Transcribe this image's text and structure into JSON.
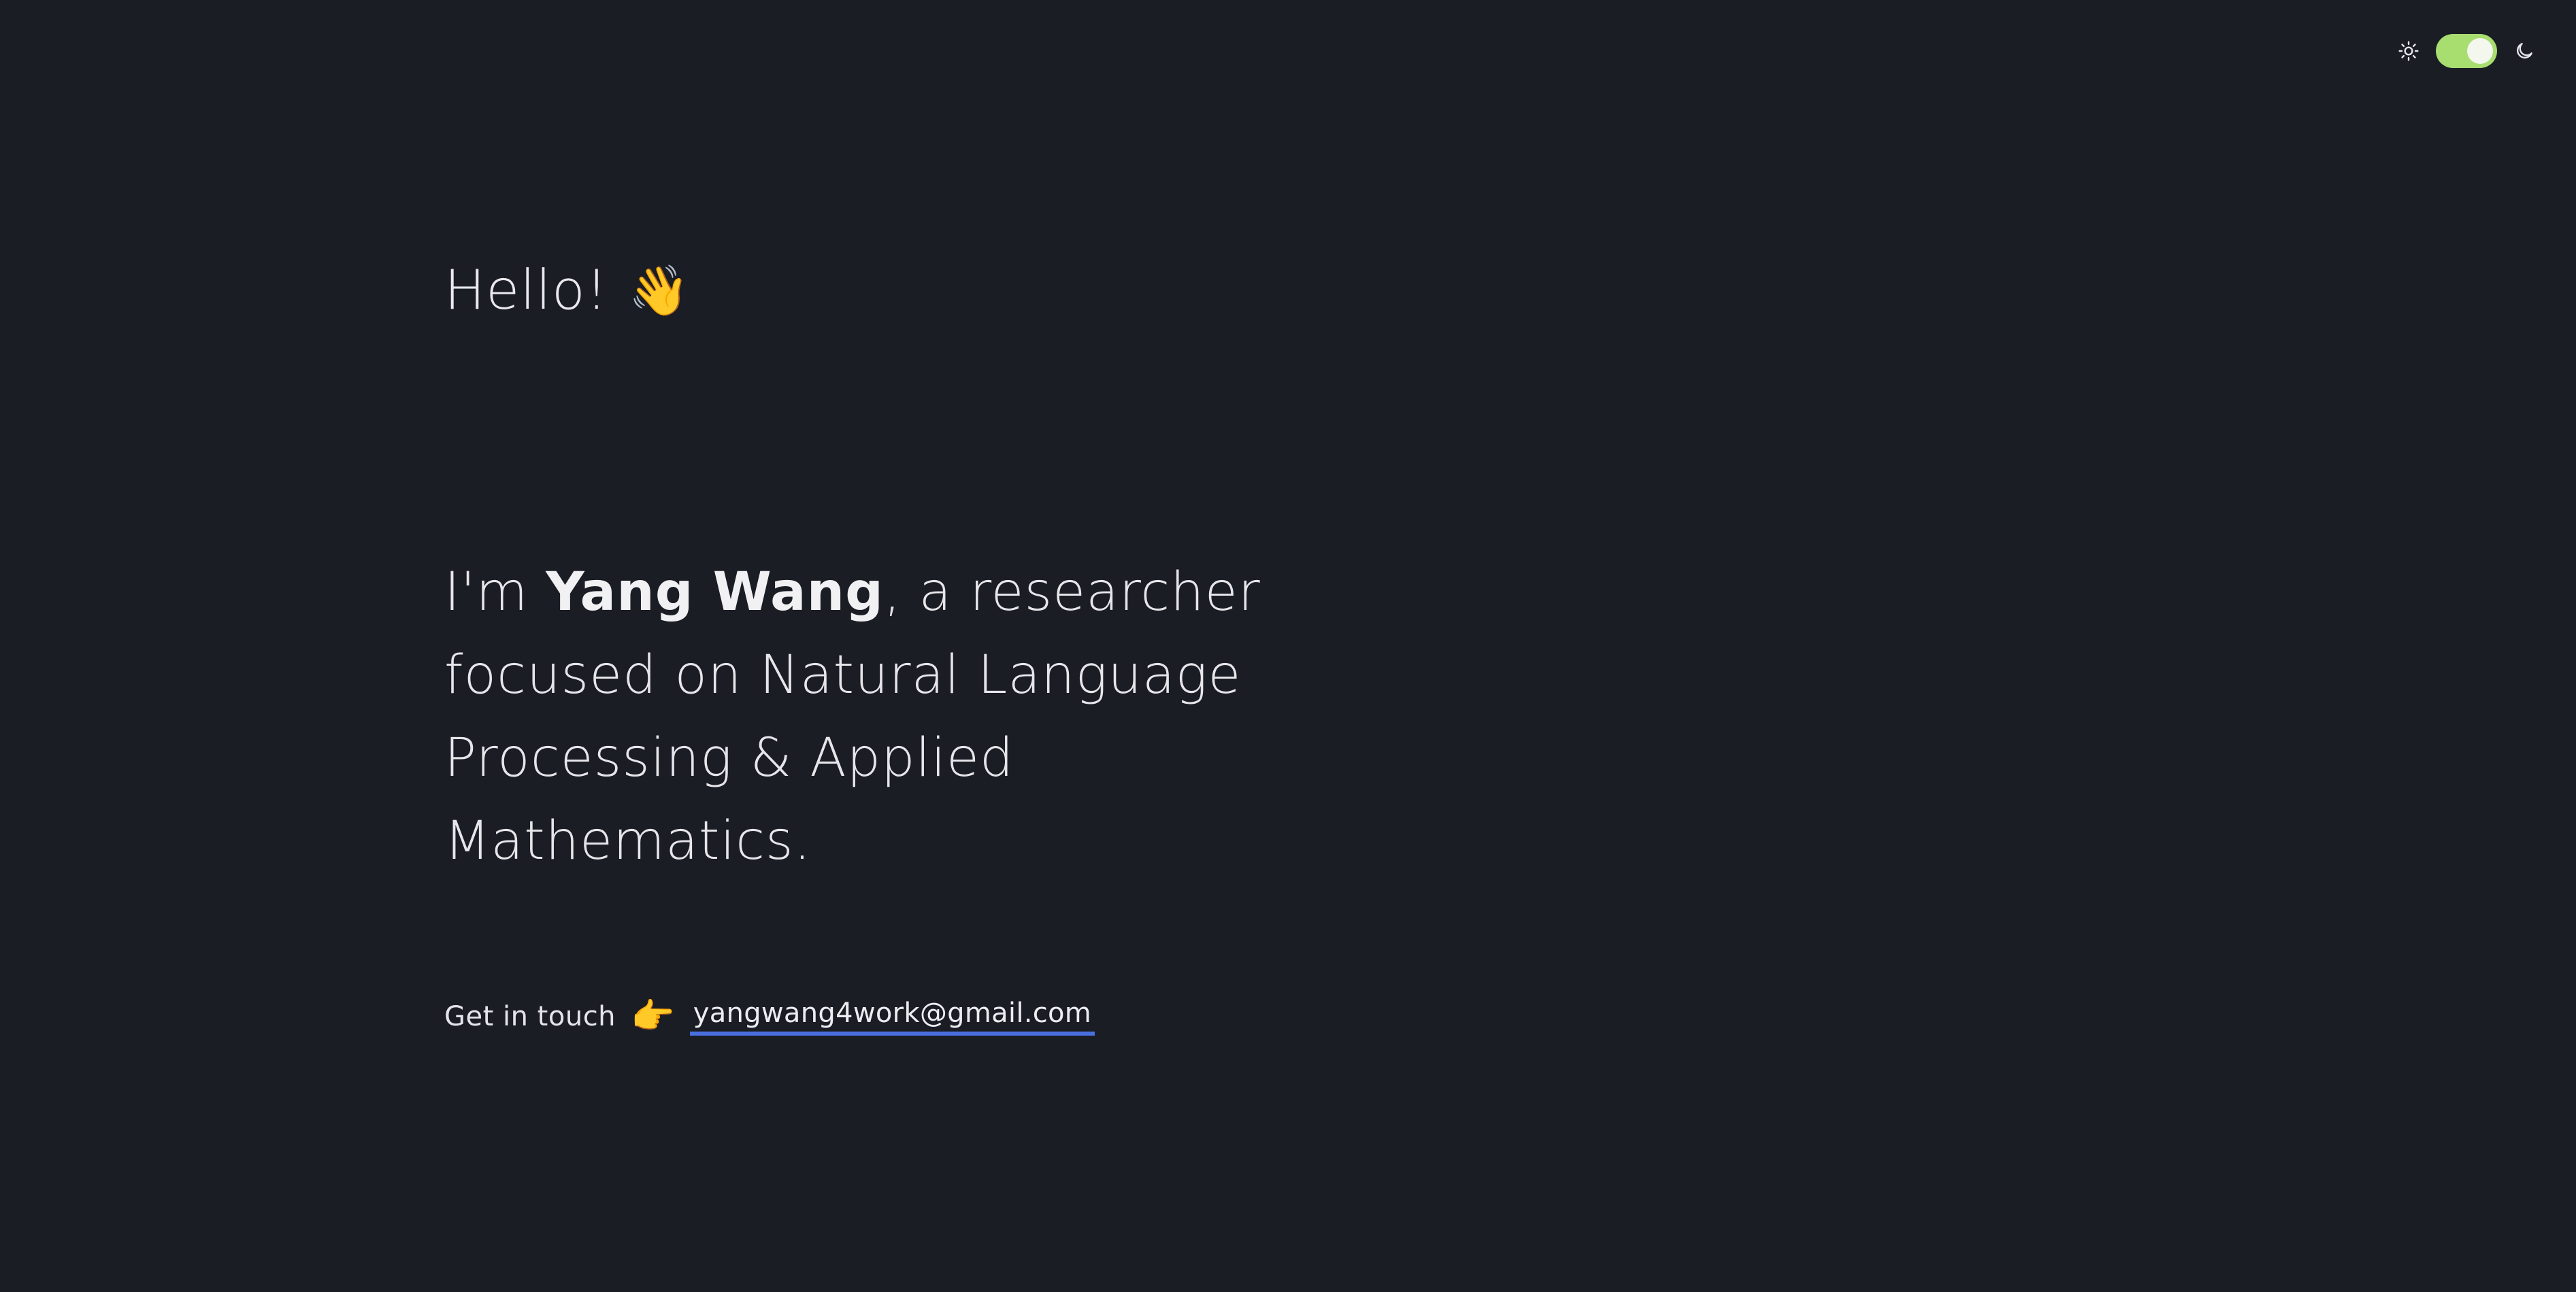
{
  "theme_switch": {
    "light_icon": "sun-icon",
    "dark_icon": "moon-icon",
    "state": "on",
    "accent_color": "#a8dd70"
  },
  "hero": {
    "greeting": "Hello!",
    "greeting_emoji": "👋",
    "intro_prefix": "I'm ",
    "name": "Yang Wang",
    "intro_suffix": ", a researcher focused on Natural Language Processing & Applied Mathematics."
  },
  "contact": {
    "label": "Get in touch",
    "pointer_emoji": "👉",
    "email": "yangwang4work@gmail.com",
    "link_underline_color": "#4a6fe0"
  },
  "colors": {
    "background": "#1b1d25",
    "text": "#e6e6ea"
  }
}
